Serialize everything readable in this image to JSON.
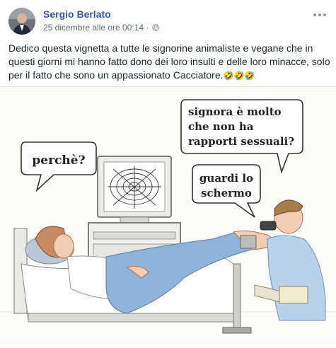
{
  "post": {
    "author": "Sergio Berlato",
    "timestamp": "25 dicembre alle ore 00:14 ·",
    "privacy_icon": "globe-icon",
    "text": "Dedico questa vignetta a tutte le signorine animaliste e vegane che in questi giorni mi hanno fatto dono dei loro insulti e delle loro minacce, solo per il fatto che sono un appassionato Cacciatore.",
    "emoji": "🤣🤣🤣"
  },
  "cartoon": {
    "bubble_patient": "perchè?",
    "bubble_doctor_1": [
      "signora è molto",
      "che non ha",
      "rapporti sessuali?"
    ],
    "bubble_doctor_2": [
      "guardi lo",
      "schermo"
    ]
  },
  "colors": {
    "link_blue": "#365899",
    "text": "#1d2129",
    "meta": "#616770",
    "gown_blue": "#8fb3d9"
  }
}
